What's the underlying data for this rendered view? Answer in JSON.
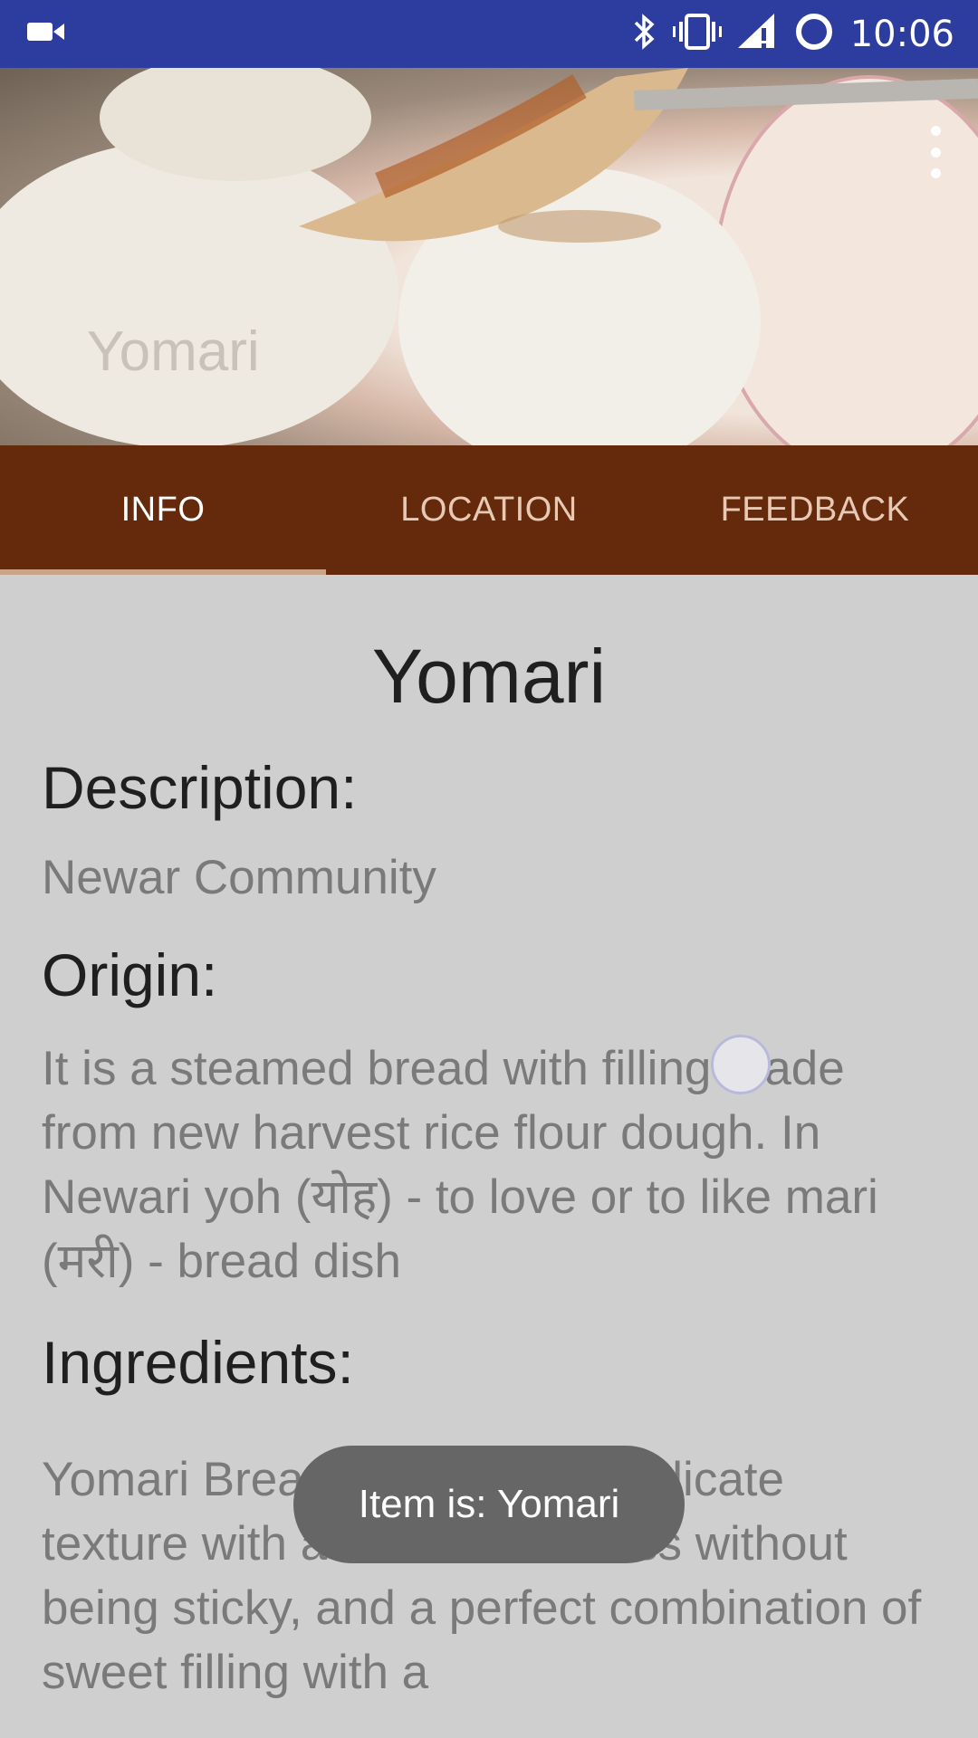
{
  "status_bar": {
    "time": "10:06",
    "icons": [
      "video-camera-icon",
      "bluetooth-icon",
      "vibrate-icon",
      "signal-icon",
      "sync-icon"
    ]
  },
  "hero": {
    "title": "Yomari",
    "menu_icon": "more-vert-icon"
  },
  "tabs": [
    {
      "label": "INFO",
      "active": true
    },
    {
      "label": "LOCATION",
      "active": false
    },
    {
      "label": "FEEDBACK",
      "active": false
    }
  ],
  "content": {
    "dish_name": "Yomari",
    "description_heading": "Description:",
    "description_text": "Newar Community",
    "origin_heading": "Origin:",
    "origin_text": "It is a steamed bread with filling made from new harvest rice flour dough. In Newari yoh (योह) - to love or to like mari (मरी) - bread dish",
    "ingredients_heading": "Ingredients:",
    "ingredients_text": "Yomari Bread. It has a soft delicate texture with a bit of chewiness without being sticky, and a perfect combination of sweet filling with a"
  },
  "toast": {
    "text": "Item is: Yomari"
  },
  "colors": {
    "status_bar": "#2d3c9f",
    "tab_bar": "#642a0b",
    "content_bg": "#cfcfcf"
  }
}
